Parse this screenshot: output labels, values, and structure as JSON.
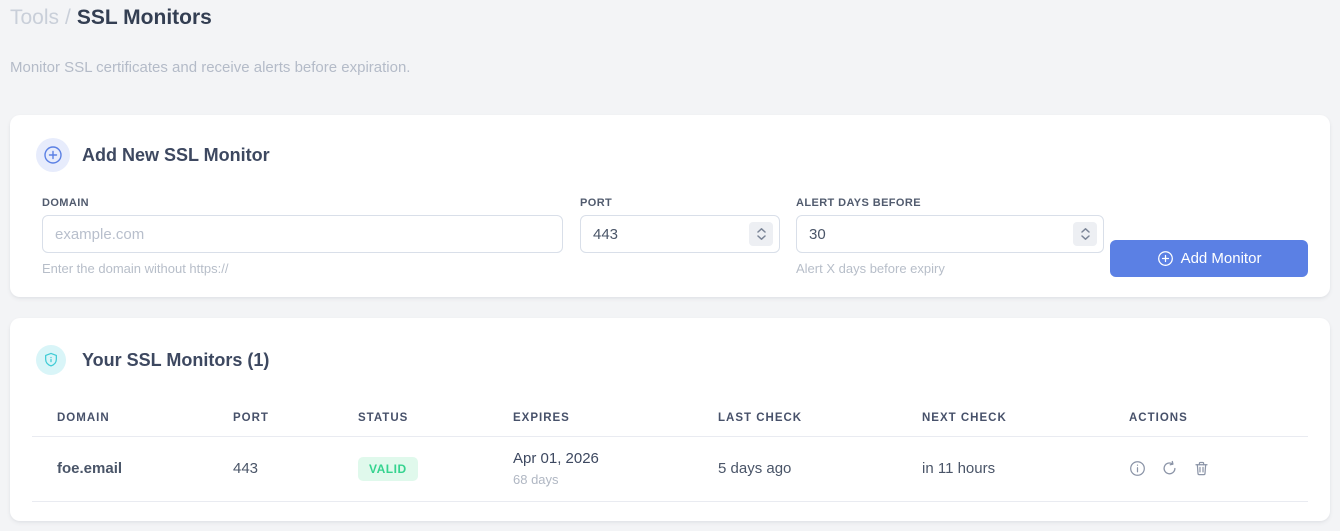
{
  "page": {
    "breadcrumb": {
      "parent": "Tools",
      "separator": "/",
      "current": "SSL Monitors"
    },
    "subtitle": "Monitor SSL certificates and receive alerts before expiration."
  },
  "add_form": {
    "title": "Add New SSL Monitor",
    "fields": {
      "domain": {
        "label": "DOMAIN",
        "placeholder": "example.com",
        "helper": "Enter the domain without https://"
      },
      "port": {
        "label": "PORT",
        "value": "443"
      },
      "alert_days": {
        "label": "ALERT DAYS BEFORE",
        "value": "30",
        "helper": "Alert X days before expiry"
      }
    },
    "submit_label": "Add Monitor"
  },
  "monitors": {
    "title": "Your SSL Monitors (1)",
    "table": {
      "headers": [
        "DOMAIN",
        "PORT",
        "STATUS",
        "EXPIRES",
        "LAST CHECK",
        "NEXT CHECK",
        "ACTIONS"
      ],
      "rows": [
        {
          "domain": "foe.email",
          "port": "443",
          "status": "VALID",
          "expires_date": "Apr 01, 2026",
          "expires_days": "68 days",
          "last_check": "5 days ago",
          "next_check": "in 11 hours"
        }
      ]
    }
  },
  "icons": {
    "header_add": "plus-circle-icon",
    "header_shield": "shield-icon",
    "row_info": "info-icon",
    "row_refresh": "refresh-icon",
    "row_delete": "trash-icon"
  },
  "colors": {
    "accent_blue": "#5b80e4",
    "next_check_blue": "#4b82e8",
    "valid_green": "#35d38f",
    "valid_green_bg": "#e0f9ec",
    "shield_cyan": "#3ecbd5",
    "page_bg": "#f3f4f6"
  }
}
